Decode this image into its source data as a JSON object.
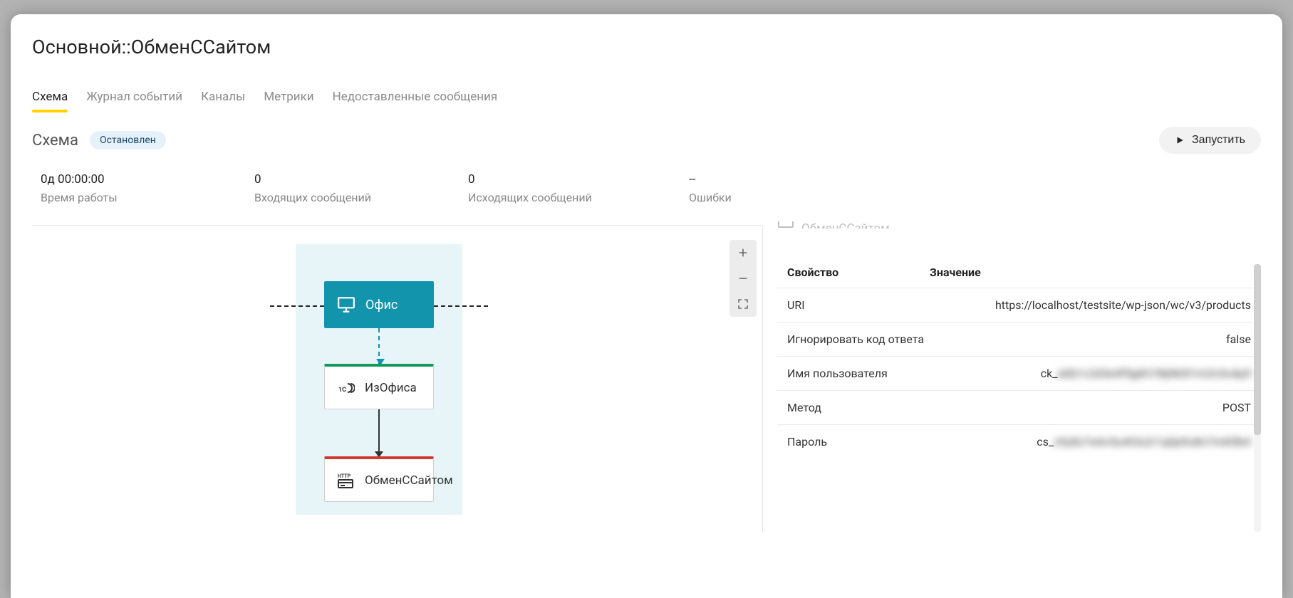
{
  "title": "Основной::ОбменССайтом",
  "tabs": [
    "Схема",
    "Журнал событий",
    "Каналы",
    "Метрики",
    "Недоставленные сообщения"
  ],
  "heading": {
    "text": "Схема",
    "status": "Остановлен"
  },
  "run_button": "Запустить",
  "metrics": [
    {
      "value": "0д 00:00:00",
      "label": "Время работы"
    },
    {
      "value": "0",
      "label": "Входящих сообщений"
    },
    {
      "value": "0",
      "label": "Исходящих сообщений"
    },
    {
      "value": "--",
      "label": "Ошибки"
    }
  ],
  "diagram": {
    "nodes": {
      "office": "Офис",
      "from_office": "ИзОфиса",
      "exchange": "ОбменССайтом"
    }
  },
  "panel": {
    "cut_header": "ОбменССайтом",
    "columns": {
      "prop": "Свойство",
      "val": "Значение"
    },
    "rows": [
      {
        "prop": "URI",
        "val": "https://localhost/testsite/wp-json/wc/v3/products",
        "blurred": false
      },
      {
        "prop": "Игнорировать код ответа",
        "val": "false",
        "blurred": false
      },
      {
        "prop": "Имя пользователя",
        "val": "ck_███████████████████████",
        "blurred": true
      },
      {
        "prop": "Метод",
        "val": "POST",
        "blurred": false
      },
      {
        "prop": "Пароль",
        "val": "cs_███████████████████████",
        "blurred": true
      }
    ]
  }
}
